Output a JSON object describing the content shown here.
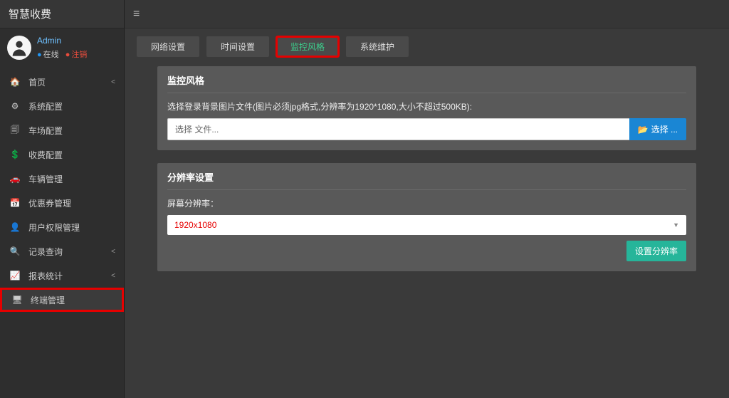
{
  "brand": "智慧收费",
  "user": {
    "name": "Admin",
    "online": "在线",
    "logout": "注销"
  },
  "nav": [
    {
      "icon": "🏠",
      "label": "首页",
      "caret": true
    },
    {
      "icon": "⚙",
      "label": "系统配置"
    },
    {
      "icon": "🗐",
      "label": "车场配置"
    },
    {
      "icon": "💲",
      "label": "收费配置"
    },
    {
      "icon": "🚗",
      "label": "车辆管理"
    },
    {
      "icon": "📅",
      "label": "优惠券管理"
    },
    {
      "icon": "👤",
      "label": "用户权限管理"
    },
    {
      "icon": "🔍",
      "label": "记录查询",
      "caret": true
    },
    {
      "icon": "📈",
      "label": "报表统计",
      "caret": true
    },
    {
      "icon": "🖥",
      "label": "终端管理",
      "active": true,
      "highlight": true
    }
  ],
  "tabs": [
    {
      "label": "网络设置"
    },
    {
      "label": "时间设置"
    },
    {
      "label": "监控风格",
      "active": true,
      "highlight": true
    },
    {
      "label": "系统维护"
    }
  ],
  "panel_style": {
    "title": "监控风格",
    "hint": "选择登录背景图片文件(图片必须jpg格式,分辨率为1920*1080,大小不超过500KB):",
    "file_placeholder": "选择 文件...",
    "browse_btn": "选择 ..."
  },
  "panel_res": {
    "title": "分辨率设置",
    "label": "屏幕分辨率：",
    "value": "1920x1080",
    "set_btn": "设置分辨率"
  }
}
